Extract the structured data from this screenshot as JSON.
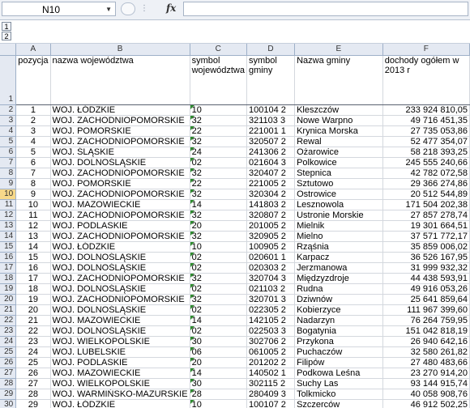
{
  "formula_bar": {
    "name_box": "N10",
    "fx_label": "fx",
    "formula_value": ""
  },
  "outline": {
    "levels": [
      "1",
      "2"
    ]
  },
  "columns": [
    "A",
    "B",
    "C",
    "D",
    "E",
    "F"
  ],
  "header_row": {
    "row_number": "1",
    "cells": [
      "pozycja",
      "nazwa województwa",
      "symbol województwa",
      "symbol gminy",
      "Nazwa gminy",
      "dochody ogółem w 2013 r"
    ]
  },
  "selected_row": "10",
  "rows": [
    {
      "row": "2",
      "pozycja": "1",
      "woj": "WOJ. ŁÓDZKIE",
      "sym_woj": "10",
      "sym_gminy": "100104 2",
      "gmina": "Kleszczów",
      "dochody": "233 924 810,05"
    },
    {
      "row": "3",
      "pozycja": "2",
      "woj": "WOJ. ZACHODNIOPOMORSKIE",
      "sym_woj": "32",
      "sym_gminy": "321103 3",
      "gmina": "Nowe Warpno",
      "dochody": "49 716 451,35"
    },
    {
      "row": "4",
      "pozycja": "3",
      "woj": "WOJ. POMORSKIE",
      "sym_woj": "22",
      "sym_gminy": "221001 1",
      "gmina": "Krynica Morska",
      "dochody": "27 735 053,86"
    },
    {
      "row": "5",
      "pozycja": "4",
      "woj": "WOJ. ZACHODNIOPOMORSKIE",
      "sym_woj": "32",
      "sym_gminy": "320507 2",
      "gmina": "Rewal",
      "dochody": "52 477 354,07"
    },
    {
      "row": "6",
      "pozycja": "5",
      "woj": "WOJ. ŚLĄSKIE",
      "sym_woj": "24",
      "sym_gminy": "241306 2",
      "gmina": "Ożarowice",
      "dochody": "58 218 393,25"
    },
    {
      "row": "7",
      "pozycja": "6",
      "woj": "WOJ. DOLNOŚLĄSKIE",
      "sym_woj": "02",
      "sym_gminy": "021604 3",
      "gmina": "Polkowice",
      "dochody": "245 555 240,66"
    },
    {
      "row": "8",
      "pozycja": "7",
      "woj": "WOJ. ZACHODNIOPOMORSKIE",
      "sym_woj": "32",
      "sym_gminy": "320407 2",
      "gmina": "Stepnica",
      "dochody": "42 782 072,58"
    },
    {
      "row": "9",
      "pozycja": "8",
      "woj": "WOJ. POMORSKIE",
      "sym_woj": "22",
      "sym_gminy": "221005 2",
      "gmina": "Sztutowo",
      "dochody": "29 366 274,86"
    },
    {
      "row": "10",
      "pozycja": "9",
      "woj": "WOJ. ZACHODNIOPOMORSKIE",
      "sym_woj": "32",
      "sym_gminy": "320304 2",
      "gmina": "Ostrowice",
      "dochody": "20 512 544,89"
    },
    {
      "row": "11",
      "pozycja": "10",
      "woj": "WOJ. MAZOWIECKIE",
      "sym_woj": "14",
      "sym_gminy": "141803 2",
      "gmina": "Lesznowola",
      "dochody": "171 504 202,38"
    },
    {
      "row": "12",
      "pozycja": "11",
      "woj": "WOJ. ZACHODNIOPOMORSKIE",
      "sym_woj": "32",
      "sym_gminy": "320807 2",
      "gmina": "Ustronie Morskie",
      "dochody": "27 857 278,74"
    },
    {
      "row": "13",
      "pozycja": "12",
      "woj": "WOJ. PODLASKIE",
      "sym_woj": "20",
      "sym_gminy": "201005 2",
      "gmina": "Mielnik",
      "dochody": "19 301 664,51"
    },
    {
      "row": "14",
      "pozycja": "13",
      "woj": "WOJ. ZACHODNIOPOMORSKIE",
      "sym_woj": "32",
      "sym_gminy": "320905 2",
      "gmina": "Mielno",
      "dochody": "37 571 772,17"
    },
    {
      "row": "15",
      "pozycja": "14",
      "woj": "WOJ. ŁÓDZKIE",
      "sym_woj": "10",
      "sym_gminy": "100905 2",
      "gmina": "Rząśnia",
      "dochody": "35 859 006,02"
    },
    {
      "row": "16",
      "pozycja": "15",
      "woj": "WOJ. DOLNOŚLĄSKIE",
      "sym_woj": "02",
      "sym_gminy": "020601 1",
      "gmina": "Karpacz",
      "dochody": "36 526 167,95"
    },
    {
      "row": "17",
      "pozycja": "16",
      "woj": "WOJ. DOLNOŚLĄSKIE",
      "sym_woj": "02",
      "sym_gminy": "020303 2",
      "gmina": "Jerzmanowa",
      "dochody": "31 999 932,32"
    },
    {
      "row": "18",
      "pozycja": "17",
      "woj": "WOJ. ZACHODNIOPOMORSKIE",
      "sym_woj": "32",
      "sym_gminy": "320704 3",
      "gmina": "Międzyzdroje",
      "dochody": "44 438 593,91"
    },
    {
      "row": "19",
      "pozycja": "18",
      "woj": "WOJ. DOLNOŚLĄSKIE",
      "sym_woj": "02",
      "sym_gminy": "021103 2",
      "gmina": "Rudna",
      "dochody": "49 916 053,26"
    },
    {
      "row": "20",
      "pozycja": "19",
      "woj": "WOJ. ZACHODNIOPOMORSKIE",
      "sym_woj": "32",
      "sym_gminy": "320701 3",
      "gmina": "Dziwnów",
      "dochody": "25 641 859,64"
    },
    {
      "row": "21",
      "pozycja": "20",
      "woj": "WOJ. DOLNOŚLĄSKIE",
      "sym_woj": "02",
      "sym_gminy": "022305 2",
      "gmina": "Kobierzyce",
      "dochody": "111 967 399,60"
    },
    {
      "row": "22",
      "pozycja": "21",
      "woj": "WOJ. MAZOWIECKIE",
      "sym_woj": "14",
      "sym_gminy": "142105 2",
      "gmina": "Nadarzyn",
      "dochody": "76 264 759,95"
    },
    {
      "row": "23",
      "pozycja": "22",
      "woj": "WOJ. DOLNOŚLĄSKIE",
      "sym_woj": "02",
      "sym_gminy": "022503 3",
      "gmina": "Bogatynia",
      "dochody": "151 042 818,19"
    },
    {
      "row": "24",
      "pozycja": "23",
      "woj": "WOJ. WIELKOPOLSKIE",
      "sym_woj": "30",
      "sym_gminy": "302706 2",
      "gmina": "Przykona",
      "dochody": "26 940 642,16"
    },
    {
      "row": "25",
      "pozycja": "24",
      "woj": "WOJ. LUBELSKIE",
      "sym_woj": "06",
      "sym_gminy": "061005 2",
      "gmina": "Puchaczów",
      "dochody": "32 580 261,82"
    },
    {
      "row": "26",
      "pozycja": "25",
      "woj": "WOJ. PODLASKIE",
      "sym_woj": "20",
      "sym_gminy": "201202 2",
      "gmina": "Filipów",
      "dochody": "27 480 483,66"
    },
    {
      "row": "27",
      "pozycja": "26",
      "woj": "WOJ. MAZOWIECKIE",
      "sym_woj": "14",
      "sym_gminy": "140502 1",
      "gmina": "Podkowa Leśna",
      "dochody": "23 270 914,20"
    },
    {
      "row": "28",
      "pozycja": "27",
      "woj": "WOJ. WIELKOPOLSKIE",
      "sym_woj": "30",
      "sym_gminy": "302115 2",
      "gmina": "Suchy Las",
      "dochody": "93 144 915,74"
    },
    {
      "row": "29",
      "pozycja": "28",
      "woj": "WOJ. WARMIŃSKO-MAZURSKIE",
      "sym_woj": "28",
      "sym_gminy": "280409 3",
      "gmina": "Tolkmicko",
      "dochody": "40 058 908,76"
    },
    {
      "row": "30",
      "pozycja": "29",
      "woj": "WOJ. ŁÓDZKIE",
      "sym_woj": "10",
      "sym_gminy": "100107 2",
      "gmina": "Szczerców",
      "dochody": "46 912 502,25"
    }
  ]
}
